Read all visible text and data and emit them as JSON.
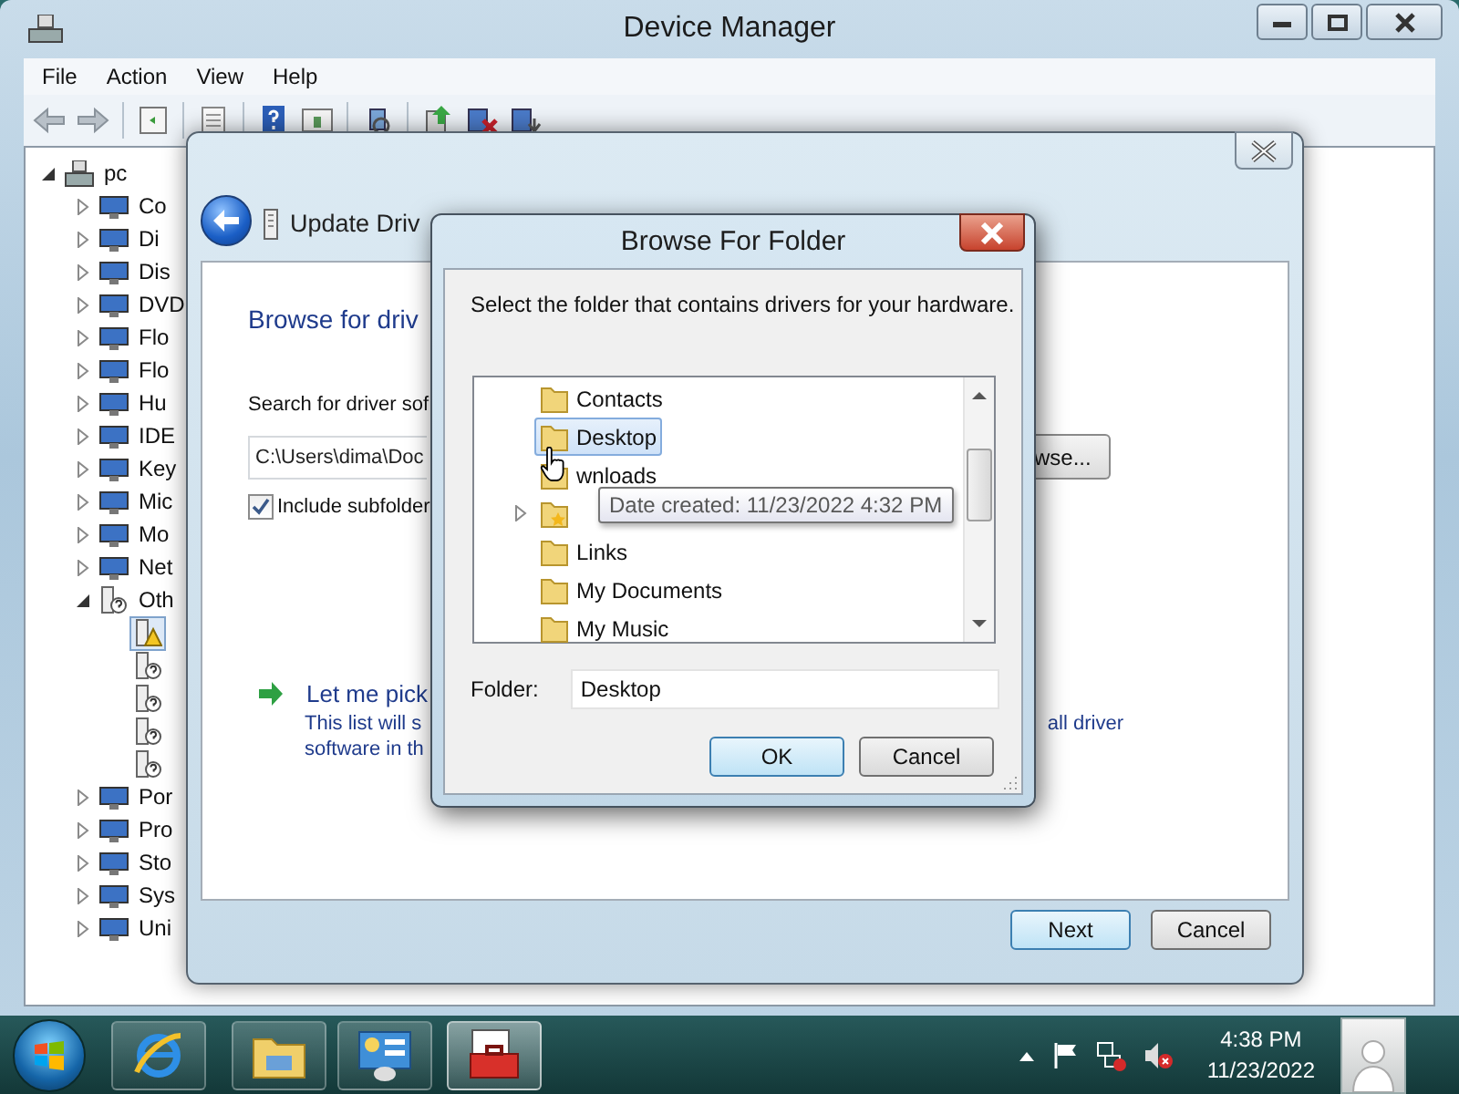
{
  "device_manager": {
    "title": "Device Manager",
    "menu": [
      "File",
      "Action",
      "View",
      "Help"
    ],
    "tree": [
      {
        "label": "pc",
        "kind": "computer",
        "expanded": true,
        "selected": false,
        "children": [
          {
            "label": "Co",
            "kind": "device",
            "expanded": false,
            "selected": false
          },
          {
            "label": "Di",
            "kind": "device",
            "expanded": false,
            "selected": false
          },
          {
            "label": "Dis",
            "kind": "device",
            "expanded": false,
            "selected": false
          },
          {
            "label": "DVD",
            "kind": "device",
            "expanded": false,
            "selected": false
          },
          {
            "label": "Flo",
            "kind": "device",
            "expanded": false,
            "selected": false
          },
          {
            "label": "Flo",
            "kind": "device",
            "expanded": false,
            "selected": false
          },
          {
            "label": "Hu",
            "kind": "device",
            "expanded": false,
            "selected": false
          },
          {
            "label": "IDE",
            "kind": "device",
            "expanded": false,
            "selected": false
          },
          {
            "label": "Key",
            "kind": "device",
            "expanded": false,
            "selected": false
          },
          {
            "label": "Mic",
            "kind": "device",
            "expanded": false,
            "selected": false
          },
          {
            "label": "Mo",
            "kind": "device",
            "expanded": false,
            "selected": false
          },
          {
            "label": "Net",
            "kind": "device",
            "expanded": false,
            "selected": false
          },
          {
            "label": "Oth",
            "kind": "unknown",
            "expanded": true,
            "selected": false,
            "children": [
              {
                "kind": "warning",
                "selected": true
              },
              {
                "kind": "unknown",
                "selected": false
              },
              {
                "kind": "unknown",
                "selected": false
              },
              {
                "kind": "unknown",
                "selected": false
              },
              {
                "kind": "unknown",
                "selected": false
              }
            ]
          },
          {
            "label": "Por",
            "kind": "device",
            "expanded": false,
            "selected": false
          },
          {
            "label": "Pro",
            "kind": "device",
            "expanded": false,
            "selected": false
          },
          {
            "label": "Sto",
            "kind": "device",
            "expanded": false,
            "selected": false
          },
          {
            "label": "Sys",
            "kind": "device",
            "expanded": false,
            "selected": false
          },
          {
            "label": "Uni",
            "kind": "device",
            "expanded": false,
            "selected": false
          }
        ]
      }
    ]
  },
  "update_driver": {
    "title": "Update Driv",
    "heading": "Browse for driv",
    "search_label": "Search for driver sof",
    "path_value": "C:\\Users\\dima\\Doc",
    "browse_button": "wse...",
    "include_subfolders": {
      "label": "Include subfolder",
      "checked": true
    },
    "pick_option": {
      "title": "Let me pick",
      "lines": [
        "This list will s",
        "software in th"
      ],
      "tail": "all driver"
    },
    "buttons": [
      {
        "label": "Next",
        "default": true
      },
      {
        "label": "Cancel",
        "default": false
      }
    ]
  },
  "browse_folder": {
    "title": "Browse For Folder",
    "instruction": "Select the folder that contains drivers for your hardware.",
    "folders": [
      {
        "label": "Contacts",
        "selected": false
      },
      {
        "label": "Desktop",
        "selected": true
      },
      {
        "label": "wnloads",
        "selected": false
      },
      {
        "selected": false,
        "expanded": false
      },
      {
        "label": "Links",
        "selected": false
      },
      {
        "label": "My Documents",
        "selected": false
      },
      {
        "label": "My Music",
        "selected": false
      }
    ],
    "tooltip": "Date created: 11/23/2022 4:32 PM",
    "folder_label": "Folder:",
    "folder_value": "Desktop",
    "buttons": [
      {
        "label": "OK",
        "default": true
      },
      {
        "label": "Cancel",
        "default": false
      }
    ]
  },
  "taskbar": {
    "apps": [
      {
        "kind": "browser",
        "active": false
      },
      {
        "kind": "explorer",
        "active": false
      },
      {
        "kind": "control-panel",
        "active": false
      },
      {
        "kind": "toolbox",
        "active": true
      }
    ],
    "time": "4:38 PM",
    "date": "11/23/2022"
  }
}
